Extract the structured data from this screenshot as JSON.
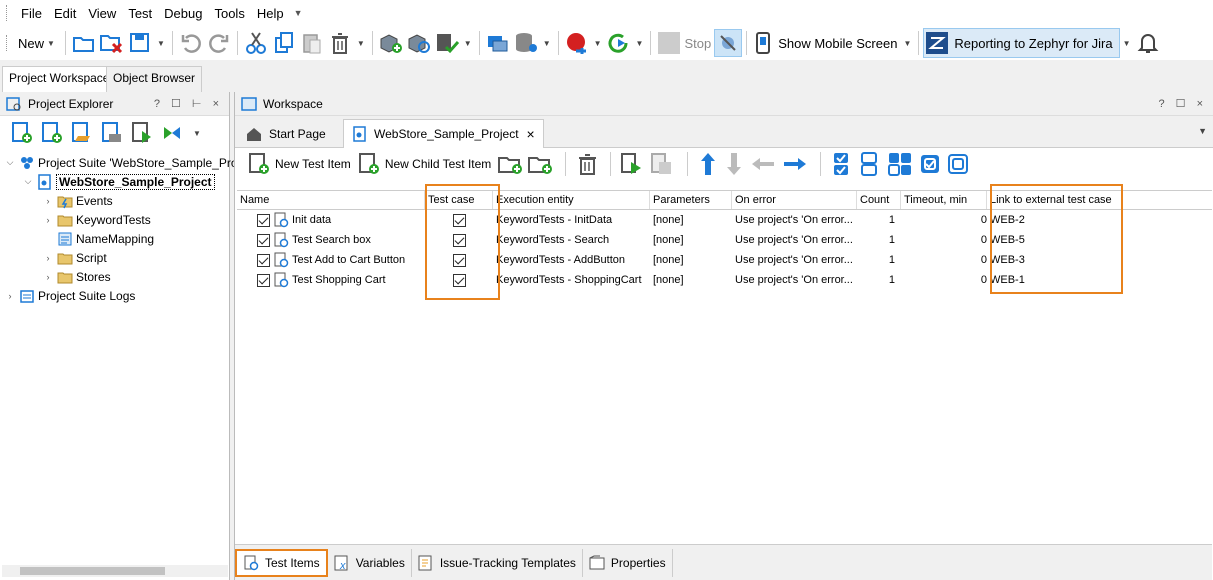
{
  "menu": {
    "items": [
      "File",
      "Edit",
      "View",
      "Test",
      "Debug",
      "Tools",
      "Help"
    ]
  },
  "toolbar": {
    "new_label": "New",
    "stop_label": "Stop",
    "mobile_label": "Show Mobile Screen",
    "zephyr_label": "Reporting to Zephyr for Jira"
  },
  "left_tabs": [
    "Project Workspace",
    "Object Browser"
  ],
  "project_explorer": {
    "title": "Project Explorer",
    "controls": "? ☐ ⊢ ×",
    "tree": [
      {
        "label": "Project Suite 'WebStore_Sample_Projec",
        "level": 0,
        "expanded": true
      },
      {
        "label": "WebStore_Sample_Project",
        "level": 1,
        "expanded": true,
        "selected": true
      },
      {
        "label": "Events",
        "level": 2,
        "expanded": false
      },
      {
        "label": "KeywordTests",
        "level": 2,
        "expanded": false
      },
      {
        "label": "NameMapping",
        "level": 2,
        "expanded": null
      },
      {
        "label": "Script",
        "level": 2,
        "expanded": false
      },
      {
        "label": "Stores",
        "level": 2,
        "expanded": false
      },
      {
        "label": "Project Suite Logs",
        "level": 0,
        "expanded": false
      }
    ]
  },
  "workspace": {
    "title": "Workspace",
    "controls": "? ☐ ×",
    "tabs": [
      {
        "label": "Start Page",
        "active": false
      },
      {
        "label": "WebStore_Sample_Project",
        "active": true
      }
    ],
    "tab_close": "×",
    "toolbar": {
      "new_test_item": "New Test Item",
      "new_child_test_item": "New Child Test Item"
    },
    "columns": [
      "Name",
      "Test case",
      "Execution entity",
      "Parameters",
      "On error",
      "Count",
      "Timeout, min",
      "Link to external test case"
    ],
    "rows": [
      {
        "name": "Init data",
        "test_case": true,
        "entity": "KeywordTests - InitData",
        "params": "[none]",
        "on_error": "Use project's 'On error...",
        "count": "1",
        "timeout": "0",
        "link": "WEB-2"
      },
      {
        "name": "Test Search box",
        "test_case": true,
        "entity": "KeywordTests - Search",
        "params": "[none]",
        "on_error": "Use project's 'On error...",
        "count": "1",
        "timeout": "0",
        "link": "WEB-5"
      },
      {
        "name": "Test Add to Cart Button",
        "test_case": true,
        "entity": "KeywordTests - AddButton",
        "params": "[none]",
        "on_error": "Use project's 'On error...",
        "count": "1",
        "timeout": "0",
        "link": "WEB-3"
      },
      {
        "name": "Test Shopping Cart",
        "test_case": true,
        "entity": "KeywordTests - ShoppingCart",
        "params": "[none]",
        "on_error": "Use project's 'On error...",
        "count": "1",
        "timeout": "0",
        "link": "WEB-1"
      }
    ],
    "bottom_tabs": [
      {
        "label": "Test Items",
        "active": true
      },
      {
        "label": "Variables",
        "active": false
      },
      {
        "label": "Issue-Tracking Templates",
        "active": false
      },
      {
        "label": "Properties",
        "active": false
      }
    ]
  },
  "colors": {
    "highlight": "#e8821c",
    "accent_blue": "#1e7ad6",
    "green": "#2aa12a"
  }
}
